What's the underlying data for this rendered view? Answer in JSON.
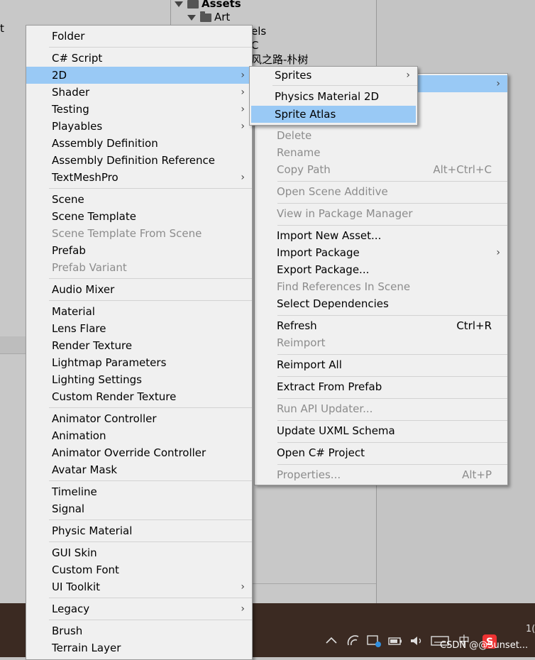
{
  "background": {
    "left_fragment": "t",
    "assets_label": "Assets",
    "art_label": "Art",
    "partial_1": "els",
    "partial_2": "C",
    "partial_3": "风之路-朴树"
  },
  "menu_create": {
    "items": [
      {
        "label": "Folder"
      },
      {
        "label": "C# Script"
      },
      {
        "label": "2D",
        "arrow": "›",
        "highlighted": true
      },
      {
        "label": "Shader",
        "arrow": "›"
      },
      {
        "label": "Testing",
        "arrow": "›"
      },
      {
        "label": "Playables",
        "arrow": "›"
      },
      {
        "label": "Assembly Definition"
      },
      {
        "label": "Assembly Definition Reference"
      },
      {
        "label": "TextMeshPro",
        "arrow": "›"
      },
      {
        "label": "Scene"
      },
      {
        "label": "Scene Template"
      },
      {
        "label": "Scene Template From Scene",
        "disabled": true
      },
      {
        "label": "Prefab"
      },
      {
        "label": "Prefab Variant",
        "disabled": true
      },
      {
        "label": "Audio Mixer"
      },
      {
        "label": "Material"
      },
      {
        "label": "Lens Flare"
      },
      {
        "label": "Render Texture"
      },
      {
        "label": "Lightmap Parameters"
      },
      {
        "label": "Lighting Settings"
      },
      {
        "label": "Custom Render Texture"
      },
      {
        "label": "Animator Controller"
      },
      {
        "label": "Animation"
      },
      {
        "label": "Animator Override Controller"
      },
      {
        "label": "Avatar Mask"
      },
      {
        "label": "Timeline"
      },
      {
        "label": "Signal"
      },
      {
        "label": "Physic Material"
      },
      {
        "label": "GUI Skin"
      },
      {
        "label": "Custom Font"
      },
      {
        "label": "UI Toolkit",
        "arrow": "›"
      },
      {
        "label": "Legacy",
        "arrow": "›"
      },
      {
        "label": "Brush"
      },
      {
        "label": "Terrain Layer"
      }
    ]
  },
  "menu_2d": {
    "items": [
      {
        "label": "Sprites",
        "arrow": "›"
      },
      {
        "label": "Physics Material 2D"
      },
      {
        "label": "Sprite Atlas",
        "highlighted": true
      }
    ]
  },
  "menu_context": {
    "items": [
      {
        "label": "",
        "arrow": "›",
        "highlighted": true
      },
      {
        "label": "Delete",
        "disabled": true
      },
      {
        "label": "Rename",
        "disabled": true
      },
      {
        "label": "Copy Path",
        "shortcut": "Alt+Ctrl+C",
        "disabled": true
      },
      {
        "label": "Open Scene Additive",
        "disabled": true
      },
      {
        "label": "View in Package Manager",
        "disabled": true
      },
      {
        "label": "Import New Asset..."
      },
      {
        "label": "Import Package",
        "arrow": "›"
      },
      {
        "label": "Export Package..."
      },
      {
        "label": "Find References In Scene",
        "disabled": true
      },
      {
        "label": "Select Dependencies"
      },
      {
        "label": "Refresh",
        "shortcut": "Ctrl+R"
      },
      {
        "label": "Reimport",
        "disabled": true
      },
      {
        "label": "Reimport All"
      },
      {
        "label": "Extract From Prefab"
      },
      {
        "label": "Run API Updater...",
        "disabled": true
      },
      {
        "label": "Update UXML Schema"
      },
      {
        "label": "Open C# Project"
      },
      {
        "label": "Properties...",
        "shortcut": "Alt+P",
        "disabled": true
      }
    ]
  },
  "taskbar": {
    "ime_label": "中",
    "watermark": "CSDN @@Sunset...",
    "edge_digit": "1("
  },
  "colors": {
    "highlight": "#99c9f5",
    "menu_bg": "#f0f0f0",
    "disabled_text": "#8c8c8c",
    "taskbar_bg": "#3b2a22"
  }
}
